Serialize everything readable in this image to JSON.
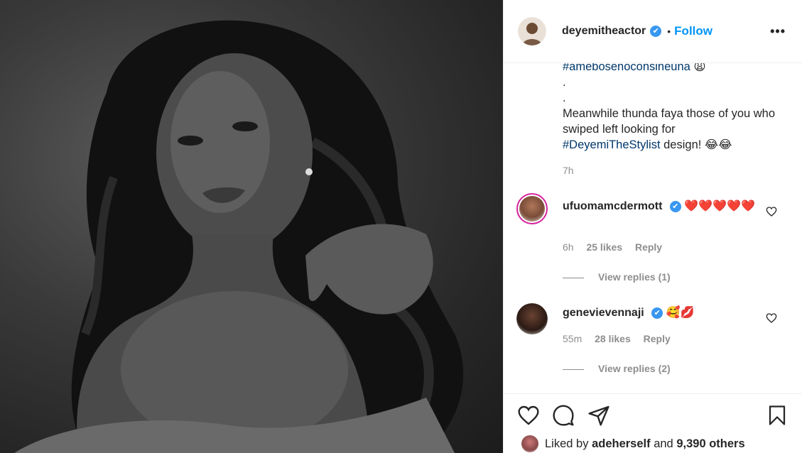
{
  "post": {
    "username": "deyemitheactor",
    "verified_mark": "✔",
    "separator": "•",
    "follow_label": "Follow",
    "more_label": "•••"
  },
  "caption": {
    "line_hashtag": "#amebosenoconsineuna",
    "line_hashtag_emoji": "😩",
    "dot1": ".",
    "dot2": ".",
    "text": "Meanwhile thunda faya those of you who swiped left looking for ",
    "hashtag2": "#DeyemiTheStylist",
    "text_end": " design! ",
    "emoji_end": "😂😂",
    "time": "7h"
  },
  "comments": [
    {
      "username": "ufuomamcdermott",
      "text": "❤️❤️❤️❤️❤️",
      "time": "6h",
      "likes": "25 likes",
      "reply_label": "Reply",
      "view_replies": "View replies (1)"
    },
    {
      "username": "genevievennaji",
      "text": "🥰💋",
      "time": "55m",
      "likes": "28 likes",
      "reply_label": "Reply",
      "view_replies": "View replies (2)"
    }
  ],
  "liked_by": {
    "prefix": "Liked by ",
    "user": "adeherself",
    "middle": " and ",
    "count": "9,390 others"
  },
  "icons": {
    "like": "heart-icon",
    "comment": "comment-icon",
    "share": "share-icon",
    "save": "bookmark-icon"
  },
  "colors": {
    "link": "#0095f6",
    "hashtag": "#00376b",
    "verified": "#3897f0",
    "muted": "#8e8e8e"
  }
}
